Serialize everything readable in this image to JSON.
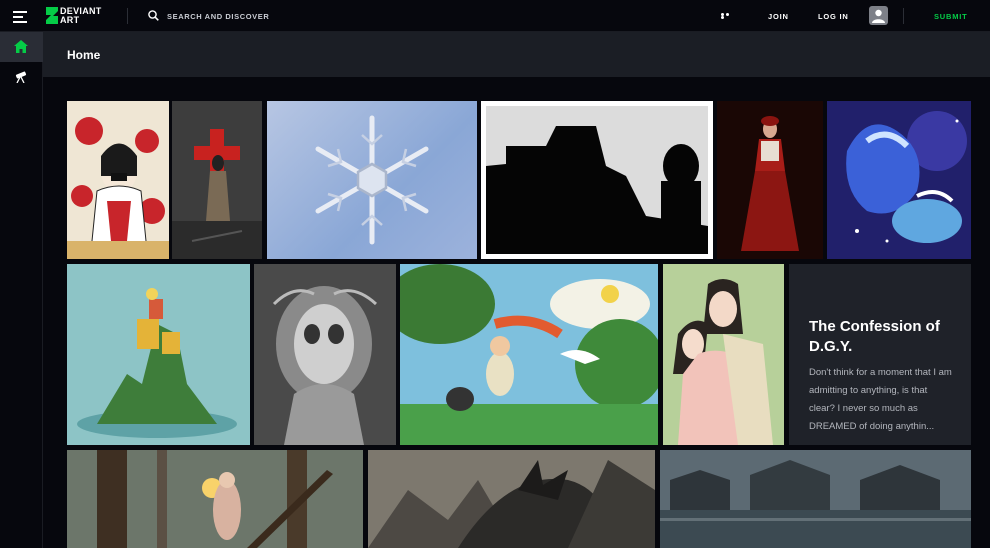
{
  "app": {
    "logo_line1": "DEVIANT",
    "logo_line2": "ART"
  },
  "search": {
    "placeholder": "SEARCH AND DISCOVER"
  },
  "topnav": {
    "join": "JOIN",
    "login": "LOG IN",
    "submit": "SUBMIT"
  },
  "sidebar": {
    "items": [
      {
        "icon": "home-icon",
        "active": true
      },
      {
        "icon": "telescope-icon",
        "active": false
      }
    ]
  },
  "page": {
    "title": "Home"
  },
  "gallery": {
    "row1": [
      {
        "subject": "floral-illustration"
      },
      {
        "subject": "cross-figure"
      },
      {
        "subject": "snowflake"
      },
      {
        "subject": "silhouette"
      },
      {
        "subject": "red-dress"
      },
      {
        "subject": "blue-horse"
      }
    ],
    "row2": [
      {
        "subject": "island-tower"
      },
      {
        "subject": "biomech-drawing"
      },
      {
        "subject": "storybook-forest"
      },
      {
        "subject": "couple-painting"
      }
    ],
    "literature": {
      "title": "The Confession of D.G.Y.",
      "excerpt": "Don't think for a moment that I am admitting to anything, is that clear? I never so much as DREAMED of doing anythin..."
    },
    "row3": [
      {
        "subject": "forest-fairy"
      },
      {
        "subject": "dragon"
      },
      {
        "subject": "misty-harbor"
      }
    ]
  },
  "colors": {
    "brand": "#05cc47",
    "background": "#06070d",
    "header": "#1b1e25"
  }
}
